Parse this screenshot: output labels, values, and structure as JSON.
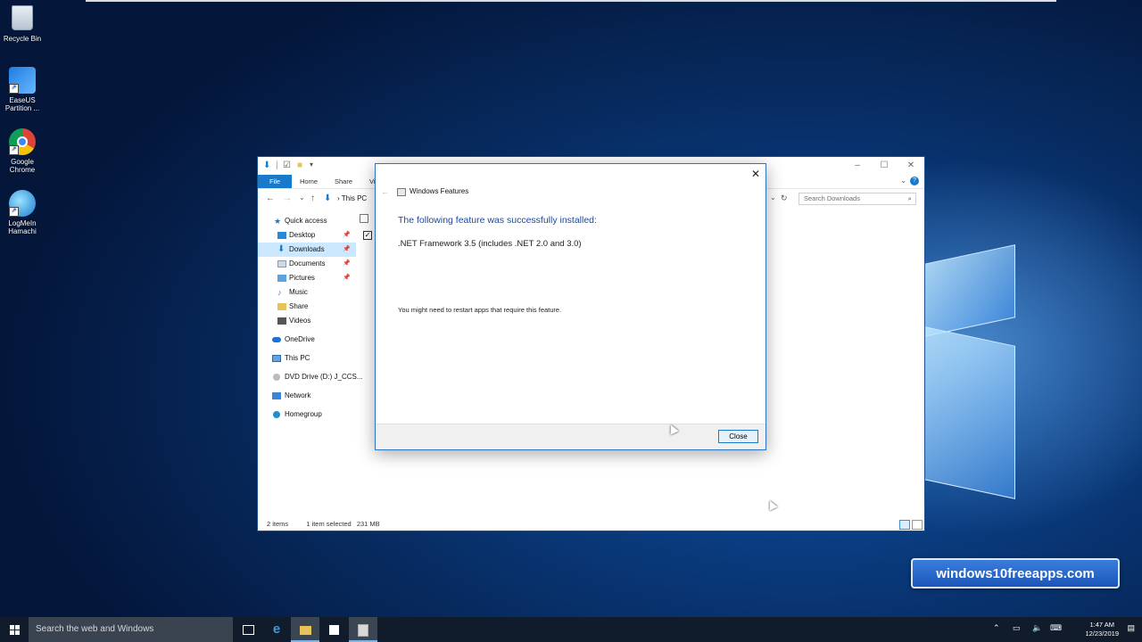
{
  "desktop": {
    "icons": [
      {
        "label": "Recycle Bin"
      },
      {
        "label": "EaseUS Partition ..."
      },
      {
        "label": "Google Chrome"
      },
      {
        "label": "LogMeIn Hamachi"
      }
    ]
  },
  "explorer": {
    "ribbon_tabs": [
      "File",
      "Home",
      "Share",
      "Vi"
    ],
    "path": "This PC",
    "search_placeholder": "Search Downloads",
    "nav": [
      {
        "label": "Quick access"
      },
      {
        "label": "Desktop"
      },
      {
        "label": "Downloads"
      },
      {
        "label": "Documents"
      },
      {
        "label": "Pictures"
      },
      {
        "label": "Music"
      },
      {
        "label": "Share"
      },
      {
        "label": "Videos"
      },
      {
        "label": "OneDrive"
      },
      {
        "label": "This PC"
      },
      {
        "label": "DVD Drive (D:) J_CCS..."
      },
      {
        "label": "Network"
      },
      {
        "label": "Homegroup"
      }
    ],
    "status": {
      "items": "2 items",
      "selected": "1 item selected",
      "size": "231 MB"
    }
  },
  "dialog": {
    "title": "Windows Features",
    "heading": "The following feature was successfully installed:",
    "feature": ".NET Framework 3.5 (includes .NET 2.0 and 3.0)",
    "note": "You might need to restart apps that require this feature.",
    "close_label": "Close"
  },
  "watermark": "windows10freeapps.com",
  "taskbar": {
    "search_placeholder": "Search the web and Windows",
    "time": "1:47 AM",
    "date": "12/23/2019"
  }
}
